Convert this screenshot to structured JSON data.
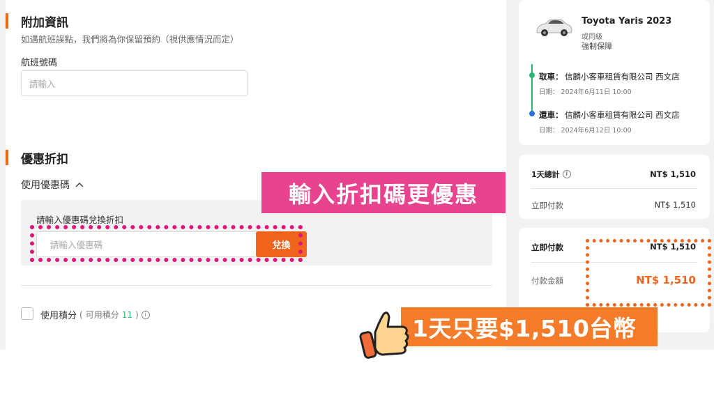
{
  "extra_info": {
    "title": "附加資訊",
    "description": "如遇航班誤點，我們將為你保留預約（視供應情況而定）",
    "flight_label": "航班號碼",
    "flight_placeholder": "請輸入"
  },
  "discount": {
    "title": "優惠折扣",
    "use_coupon_label": "使用優惠碼",
    "coupon_prompt": "請輸入優惠碼兌換折扣",
    "coupon_placeholder": "請輸入優惠碼",
    "redeem_label": "兌換",
    "use_points_label": "使用積分",
    "points_open": "(",
    "points_prefix": "可用積分",
    "points_value": "11",
    "points_close": ")"
  },
  "car": {
    "name": "Toyota Yaris 2023",
    "class": "或同級",
    "insurance": "強制保障",
    "pickup_label": "取車：",
    "pickup_location": "信麟小客車租賃有限公司 西文店",
    "pickup_date": "日期： 2024年6月11日 10:00",
    "return_label": "還車：",
    "return_location": "信麟小客車租賃有限公司 西文店",
    "return_date": "日期： 2024年6月12日 10:00"
  },
  "summary": {
    "total_label": "1天總計",
    "total_value": "NT$ 1,510",
    "pay_now_label": "立即付款",
    "pay_now_value": "NT$ 1,510"
  },
  "payment": {
    "pay_now_label": "立即付款",
    "pay_now_value": "NT$ 1,510",
    "amount_label": "付款金額",
    "amount_value": "NT$ 1,510"
  },
  "banners": {
    "pink": "輸入折扣碼更優惠",
    "orange": "1天只要$1,510台幣"
  },
  "colors": {
    "accent": "#f0641e",
    "pink": "#e8438f",
    "timeline": "#2bb673",
    "blue_dot": "#2a6fdb"
  }
}
